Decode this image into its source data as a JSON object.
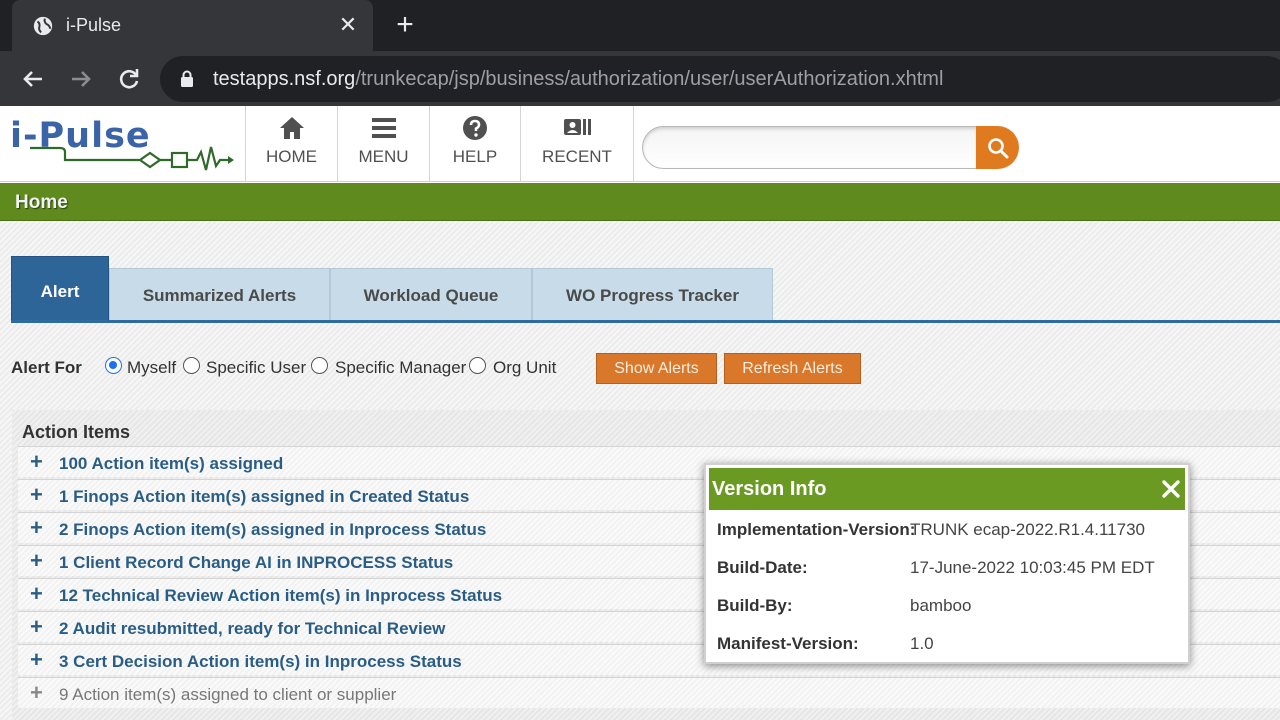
{
  "browser": {
    "tab_title": "i-Pulse",
    "tab_close": "✕",
    "new_tab": "+",
    "url_host": "testapps.nsf.org",
    "url_path": "/trunkecap/jsp/business/authorization/user/userAuthorization.xhtml"
  },
  "header": {
    "logo_text": "i-Pulse",
    "nav": [
      {
        "label": "HOME",
        "icon": "home-icon"
      },
      {
        "label": "MENU",
        "icon": "menu-icon"
      },
      {
        "label": "HELP",
        "icon": "help-icon"
      },
      {
        "label": "RECENT",
        "icon": "recent-icon"
      }
    ],
    "search_placeholder": ""
  },
  "breadcrumb": "Home",
  "tabs": [
    "Alert",
    "Summarized Alerts",
    "Workload Queue",
    "WO Progress Tracker"
  ],
  "active_tab": "Alert",
  "alert_for": {
    "label": "Alert For",
    "options": [
      "Myself",
      "Specific User",
      "Specific Manager",
      "Org Unit"
    ],
    "selected": "Myself",
    "show_button": "Show Alerts",
    "refresh_button": "Refresh Alerts"
  },
  "action_items": {
    "title": "Action Items",
    "expand_symbol": "+",
    "rows": [
      "100 Action item(s) assigned",
      "1 Finops Action item(s) assigned in Created Status",
      "2 Finops Action item(s) assigned in Inprocess Status",
      "1 Client Record Change AI in INPROCESS Status",
      "12 Technical Review Action item(s) in Inprocess Status",
      "2 Audit resubmitted, ready for Technical Review",
      "3 Cert Decision Action item(s) in Inprocess Status",
      "9 Action item(s) assigned to client or supplier"
    ]
  },
  "version_dialog": {
    "title": "Version Info",
    "fields": [
      {
        "key": "Implementation-Version:",
        "value": "TRUNK ecap-2022.R1.4.11730"
      },
      {
        "key": "Build-Date:",
        "value": "17-June-2022 10:03:45 PM EDT"
      },
      {
        "key": "Build-By:",
        "value": "bamboo"
      },
      {
        "key": "Manifest-Version:",
        "value": "1.0"
      }
    ]
  },
  "colors": {
    "header_green": "#5f8a1e",
    "tab_blue": "#2e6599",
    "button_orange": "#d9772a",
    "link_blue": "#2a5d86"
  }
}
